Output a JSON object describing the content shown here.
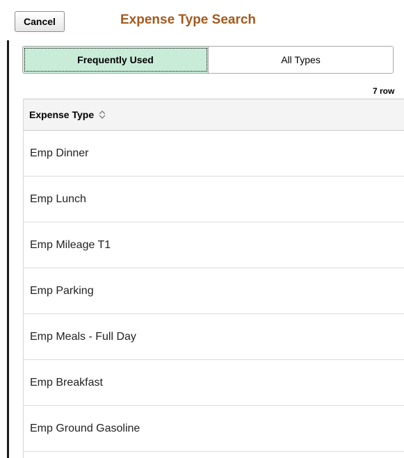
{
  "header": {
    "cancel_label": "Cancel",
    "title": "Expense Type Search"
  },
  "tabs": [
    {
      "label": "Frequently Used",
      "selected": true
    },
    {
      "label": "All Types",
      "selected": false
    }
  ],
  "grid": {
    "row_count_text": "7 row",
    "column_header": "Expense Type",
    "rows": [
      "Emp Dinner",
      "Emp Lunch",
      "Emp Mileage T1",
      "Emp Parking",
      "Emp Meals - Full Day",
      "Emp Breakfast",
      "Emp Ground Gasoline"
    ]
  },
  "colors": {
    "title": "#a35a1e",
    "selected_tab": "#c9ecd9"
  },
  "icons": {
    "sort": "sort-up-down-icon"
  }
}
